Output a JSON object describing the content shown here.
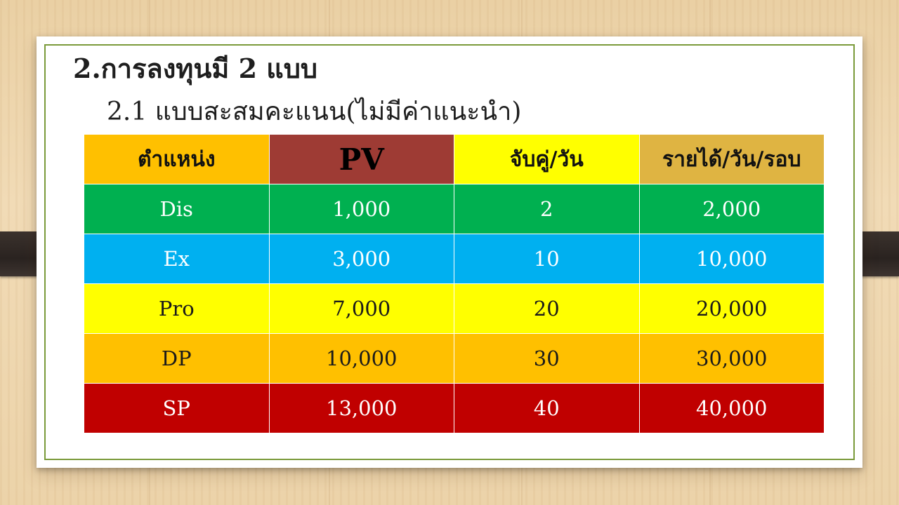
{
  "slide": {
    "title": "2.การลงทุนมี 2 แบบ",
    "subtitle": "2.1 แบบสะสมคะแนน(ไม่มีค่าแนะนำ)"
  },
  "table": {
    "headers": [
      {
        "label": "ตำแหน่ง",
        "bg": "#ffc000"
      },
      {
        "label": "PV",
        "bg": "#9e3b34"
      },
      {
        "label": "จับคู่/วัน",
        "bg": "#ffff00"
      },
      {
        "label": "รายได้/วัน/รอบ",
        "bg": "#dfb442"
      }
    ],
    "rows": [
      {
        "cells": [
          "Dis",
          "1,000",
          "2",
          "2,000"
        ],
        "bg": "#00b050",
        "color": "#ffffff"
      },
      {
        "cells": [
          "Ex",
          "3,000",
          "10",
          "10,000"
        ],
        "bg": "#00b0f0",
        "color": "#ffffff"
      },
      {
        "cells": [
          "Pro",
          "7,000",
          "20",
          "20,000"
        ],
        "bg": "#ffff00",
        "color": "#1a1a1a"
      },
      {
        "cells": [
          "DP",
          "10,000",
          "30",
          "30,000"
        ],
        "bg": "#ffc000",
        "color": "#1a1a1a"
      },
      {
        "cells": [
          "SP",
          "13,000",
          "40",
          "40,000"
        ],
        "bg": "#c00000",
        "color": "#ffffff"
      }
    ]
  },
  "theme": {
    "frame_color": "#7a9a3a",
    "strap_color": "#2f2824"
  }
}
